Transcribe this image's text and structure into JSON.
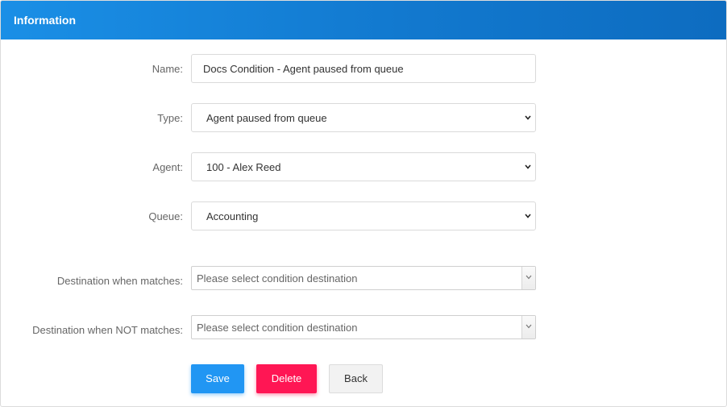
{
  "panel": {
    "title": "Information"
  },
  "form": {
    "name": {
      "label": "Name:",
      "value": "Docs Condition - Agent paused from queue"
    },
    "type": {
      "label": "Type:",
      "value": "Agent paused from queue"
    },
    "agent": {
      "label": "Agent:",
      "value": "100 - Alex Reed"
    },
    "queue": {
      "label": "Queue:",
      "value": "Accounting"
    },
    "dest_match": {
      "label": "Destination when matches:",
      "placeholder": "Please select condition destination"
    },
    "dest_nomatch": {
      "label": "Destination when NOT matches:",
      "placeholder": "Please select condition destination"
    }
  },
  "buttons": {
    "save": "Save",
    "delete": "Delete",
    "back": "Back"
  },
  "colors": {
    "header": "#1a8fe6",
    "save": "#2196f3",
    "delete": "#ff1654",
    "back": "#f2f2f2"
  },
  "icons": {
    "select_arrow": "chevron-down-icon"
  }
}
